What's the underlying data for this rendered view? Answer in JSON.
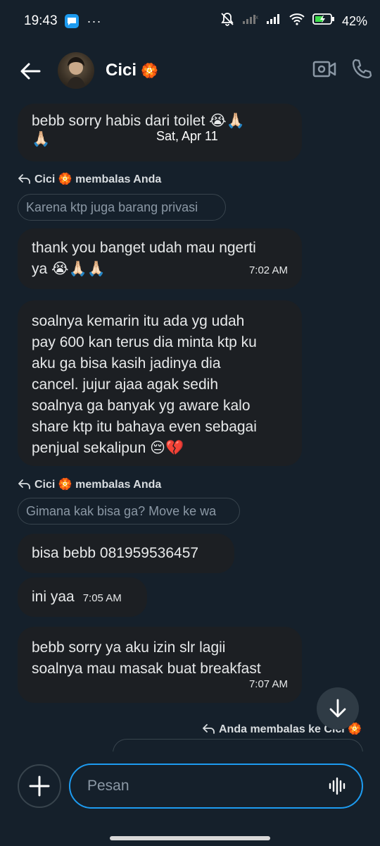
{
  "status_bar": {
    "time": "19:43",
    "dots": "···",
    "battery": "42%"
  },
  "header": {
    "contact_name": "Cici",
    "name_badge": "🏵️"
  },
  "messages": [
    {
      "text_line1": "bebb sorry habis dari toilet 😭🙏🏻",
      "text_line2": "🙏🏻"
    },
    {
      "reply_label": "Cici 🏵️ membalas Anda",
      "quote": "Karena ktp juga barang privasi"
    },
    {
      "text_line1": "thank you banget udah mau ngerti",
      "text_line2": "ya 😭🙏🏻🙏🏻",
      "time": "7:02 AM"
    },
    {
      "lines": [
        "soalnya kemarin itu ada yg udah",
        "pay 600 kan terus dia minta ktp ku",
        "aku ga bisa kasih jadinya dia",
        "cancel. jujur ajaa agak sedih",
        "soalnya ga banyak yg aware kalo",
        "share ktp itu bahaya even sebagai",
        "penjual sekalipun 😔💔"
      ]
    },
    {
      "reply_label": "Cici 🏵️ membalas Anda",
      "quote": "Gimana kak bisa ga? Move ke wa"
    },
    {
      "text": "bisa bebb 081959536457"
    },
    {
      "text": "ini yaa",
      "time": "7:05 AM"
    },
    {
      "text_line1": "bebb sorry ya aku izin slr lagii",
      "text_line2": "soalnya mau masak buat breakfast",
      "time": "7:07 AM"
    },
    {
      "reply_label": "Anda membalas ke Cici 🏵️"
    }
  ],
  "date_separator": "Sat, Apr 11",
  "composer": {
    "placeholder": "Pesan"
  }
}
